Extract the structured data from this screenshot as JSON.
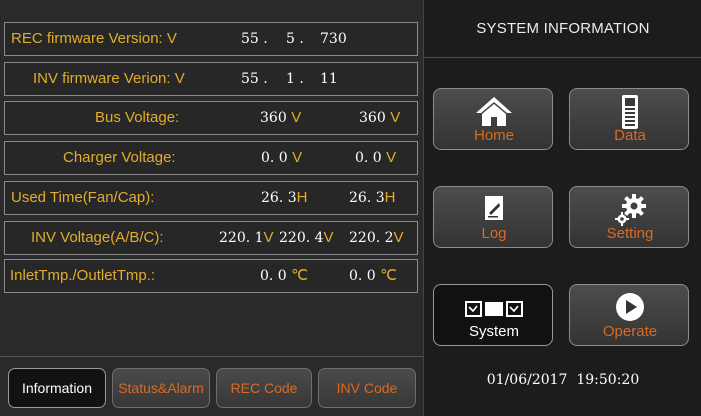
{
  "rows": [
    {
      "label": "REC firmware Version: V",
      "values": [
        "55 .",
        "5 .",
        "730"
      ]
    },
    {
      "label": "INV firmware Verion: V",
      "values": [
        "55 .",
        "1 .",
        "11"
      ]
    },
    {
      "label": "Bus Voltage:",
      "v1": "360",
      "u1": "V",
      "v2": "360",
      "u2": "V"
    },
    {
      "label": "Charger Voltage:",
      "v1": "0. 0",
      "u1": "V",
      "v2": "0. 0",
      "u2": "V"
    },
    {
      "label": "Used Time(Fan/Cap):",
      "v1": "26. 3",
      "u1": "H",
      "v2": "26. 3",
      "u2": "H"
    },
    {
      "label": "INV Voltage(A/B/C):",
      "v1": "220. 1",
      "u1": "V",
      "v2": "220. 4",
      "u2": "V",
      "v3": "220. 2",
      "u3": "V"
    },
    {
      "label": "InletTmp./OutletTmp.:",
      "v1": "0. 0",
      "u1": "℃",
      "v2": "0. 0",
      "u2": "℃"
    }
  ],
  "tabs": [
    "Information",
    "Status&Alarm",
    "REC Code",
    "INV Code"
  ],
  "system_title": "SYSTEM INFORMATION",
  "buttons": {
    "home": "Home",
    "data": "Data",
    "log": "Log",
    "setting": "Setting",
    "system": "System",
    "operate": "Operate"
  },
  "datetime": "01/06/2017  19:50:20",
  "colors": {
    "label": "#e2ad2a",
    "accent": "#d96a20",
    "background": "#2b2b2b"
  }
}
